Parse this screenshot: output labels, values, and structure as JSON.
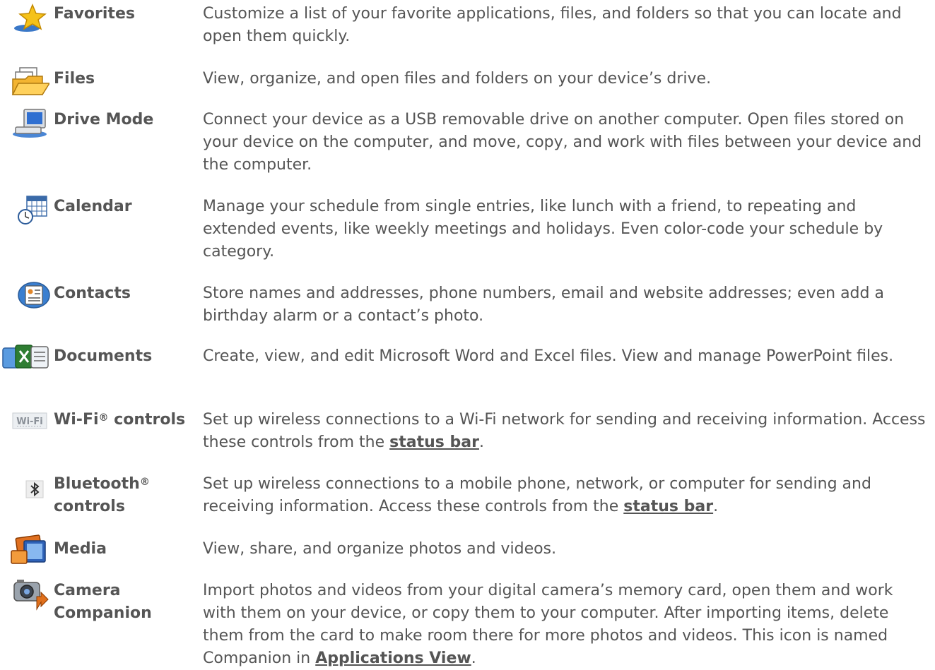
{
  "rows": [
    {
      "name": "Favorites",
      "icon": "favorites-star-icon",
      "desc": "Customize a list of your favorite applications, files, and folders so that you can locate and open them quickly."
    },
    {
      "name": "Files",
      "icon": "files-folder-icon",
      "desc": "View, organize, and open files and folders on your device’s drive."
    },
    {
      "name": "Drive Mode",
      "icon": "computer-drive-icon",
      "desc": "Connect your device as a USB removable drive on another computer. Open files stored on your device on the computer, and move, copy, and work with files between your device and the computer."
    },
    {
      "name": "Calendar",
      "icon": "calendar-clock-icon",
      "desc": "Manage your schedule from single entries, like lunch with a friend, to repeating and extended events, like weekly meetings and holidays. Even color-code your schedule by category."
    },
    {
      "name": "Contacts",
      "icon": "contacts-card-icon",
      "desc": "Store names and addresses, phone numbers, email and website addresses; even add a birthday alarm or a contact’s photo."
    },
    {
      "name": "Documents",
      "icon": "documents-icon",
      "desc": "Create, view, and edit Microsoft Word and Excel files. View and manage PowerPoint files."
    },
    {
      "name": "Wi-Fi",
      "reg": "®",
      "name_tail": " controls",
      "icon": "wifi-icon",
      "icon_label": "Wi-Fi",
      "desc_before": "Set up wireless connections to a Wi-Fi network for sending and receiving information. Access these controls from the ",
      "link": "status bar",
      "desc_after": "."
    },
    {
      "name": "Bluetooth",
      "reg": "®",
      "name_line2": "controls",
      "icon": "bluetooth-icon",
      "desc_before": "Set up wireless connections to a mobile phone, network, or computer for sending and receiving information. Access these controls from the ",
      "link": "status bar",
      "desc_after": "."
    },
    {
      "name": "Media",
      "icon": "media-photos-icon",
      "desc": "View, share, and organize photos and videos."
    },
    {
      "name": "Camera",
      "name_line2": "Companion",
      "icon": "camera-companion-icon",
      "desc_before": "Import photos and videos from your digital camera’s memory card, open them and work with them on your device, or copy them to your computer. After importing items, delete them from the card to make room there for more photos and videos. This icon is named Companion in ",
      "link": "Applications View",
      "desc_after": "."
    }
  ]
}
